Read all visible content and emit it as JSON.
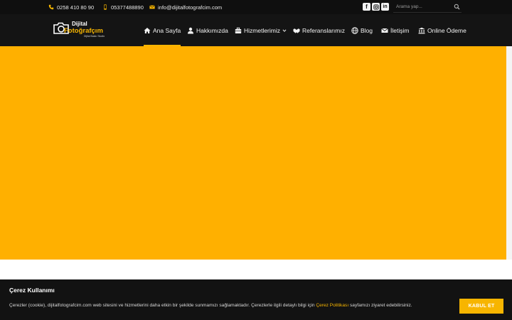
{
  "topbar": {
    "phone": "0258 410 80 90",
    "mobile": "05377488890",
    "email": "info@dijitalfotografcim.com",
    "social": [
      "facebook-icon",
      "instagram-icon",
      "linkedin-icon"
    ],
    "search_placeholder": "Arama yap..."
  },
  "logo": {
    "line1": "Dijital",
    "line2": "Fotoğrafçım",
    "tagline": "Dijital Baskı Studio"
  },
  "nav": {
    "items": [
      {
        "label": "Ana Sayfa",
        "icon": "home-icon",
        "active": true
      },
      {
        "label": "Hakkımızda",
        "icon": "user-icon"
      },
      {
        "label": "Hizmetlerimiz",
        "icon": "briefcase-icon",
        "dropdown": true
      },
      {
        "label": "Referanslarımız",
        "icon": "handshake-icon"
      },
      {
        "label": "Blog",
        "icon": "globe-icon"
      },
      {
        "label": "İletişim",
        "icon": "envelope-icon"
      },
      {
        "label": "Online Ödeme",
        "icon": "bank-icon"
      }
    ]
  },
  "colors": {
    "accent": "#f7b500",
    "hero": "#ffb000",
    "dark": "#141414"
  },
  "cookie": {
    "title": "Çerez Kullanımı",
    "text_before": "Çerezler (cookie), dijitalfotografcim.com web sitesini ve hizmetlerini daha etkin bir şekilde sunmamızı sağlamaktadır. Çerezlerle ilgili detaylı bilgi için ",
    "link": "Çerez Politikası",
    "text_after": " sayfamızı ziyaret edebilirsiniz.",
    "accept": "KABUL ET"
  }
}
